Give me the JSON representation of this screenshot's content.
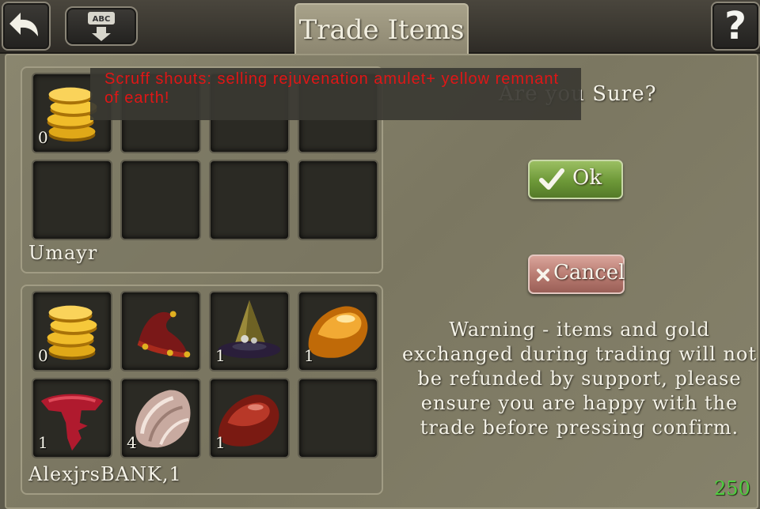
{
  "header": {
    "title": "Trade Items",
    "help_label": "?",
    "keyboard_icon_text": "ABC"
  },
  "chat": {
    "message": "Scruff shouts: selling rejuvenation amulet+ yellow remnant of earth!"
  },
  "trade_panel_self": {
    "player_name": "Umayr",
    "slots": [
      {
        "item": "gold-coins",
        "qty": "0"
      },
      {
        "item": "empty"
      },
      {
        "item": "empty"
      },
      {
        "item": "empty"
      },
      {
        "item": "empty"
      },
      {
        "item": "empty"
      },
      {
        "item": "empty"
      },
      {
        "item": "empty"
      }
    ]
  },
  "trade_panel_other": {
    "player_name": "AlexjrsBANK,1",
    "slots": [
      {
        "item": "gold-coins",
        "qty": "0"
      },
      {
        "item": "jester-hat"
      },
      {
        "item": "witch-hat",
        "qty": "1"
      },
      {
        "item": "amber-gem",
        "qty": "1"
      },
      {
        "item": "crimson-relic",
        "qty": "1"
      },
      {
        "item": "banded-stone",
        "qty": "4"
      },
      {
        "item": "red-gem",
        "qty": "1"
      },
      {
        "item": "empty"
      }
    ]
  },
  "confirm": {
    "question": "Are you Sure?",
    "ok_label": "Ok",
    "cancel_label": "Cancel",
    "warning": "Warning - items and gold exchanged during trading will not be refunded by support, please ensure you are happy with the trade before pressing confirm."
  },
  "counter": "250",
  "colors": {
    "chat_text": "#e01616",
    "counter": "#4fcf3f"
  }
}
